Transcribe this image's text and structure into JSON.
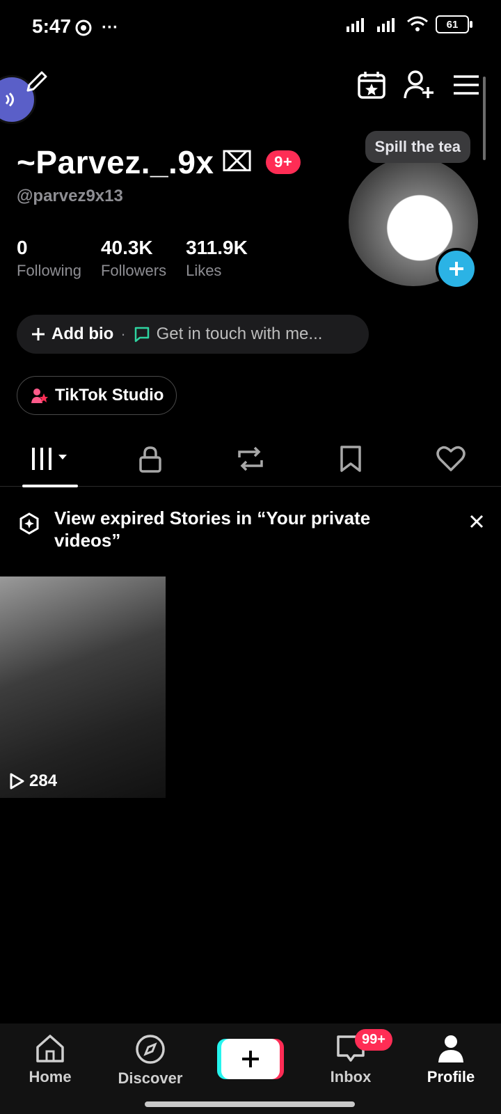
{
  "status": {
    "time": "5:47",
    "battery": "61",
    "dots": "···"
  },
  "header": {
    "calendar_icon": "calendar-star-icon",
    "add_friend_icon": "person-add-icon",
    "menu_icon": "hamburger-menu-icon",
    "edit_icon": "pencil-icon"
  },
  "profile": {
    "display_name": "~Parvez._.9x",
    "name_glyph": "⌧",
    "notif_badge": "9+",
    "username": "@parvez9x13",
    "bubble": "Spill the tea",
    "stats": [
      {
        "value": "0",
        "label": "Following"
      },
      {
        "value": "40.3K",
        "label": "Followers"
      },
      {
        "value": "311.9K",
        "label": "Likes"
      }
    ],
    "add_bio": "Add bio",
    "separator": "·",
    "get_in_touch": "Get in touch with me...",
    "studio": "TikTok Studio"
  },
  "tabs": [
    {
      "icon": "grid-videos-icon",
      "active": true
    },
    {
      "icon": "lock-icon"
    },
    {
      "icon": "repost-icon"
    },
    {
      "icon": "bookmark-icon"
    },
    {
      "icon": "heart-icon"
    }
  ],
  "banner": {
    "text": "View expired Stories in “Your private videos”"
  },
  "videos": [
    {
      "views": "284"
    }
  ],
  "nav": {
    "home": "Home",
    "discover": "Discover",
    "inbox": "Inbox",
    "inbox_badge": "99+",
    "profile": "Profile"
  },
  "colors": {
    "accent_red": "#ff2d55",
    "accent_blue": "#2bb3e5",
    "accent_cyan": "#25f4ee",
    "background": "#000000"
  }
}
